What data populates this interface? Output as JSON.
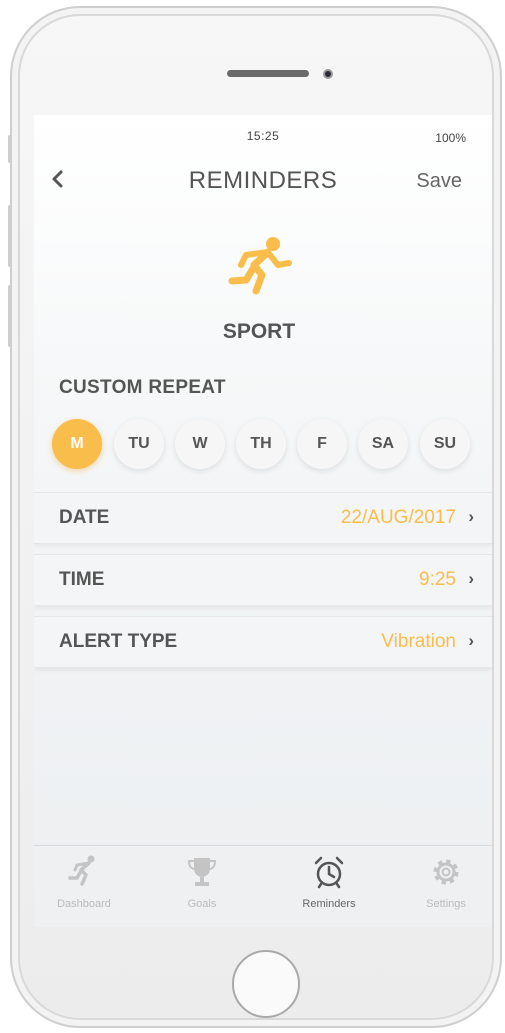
{
  "status": {
    "time": "15:25",
    "battery": "100%"
  },
  "nav": {
    "back_icon": "chevron-left-icon",
    "back_label": "‹",
    "title": "REMINDERS",
    "save_label": "Save"
  },
  "reminder": {
    "icon": "running-person-icon",
    "category": "SPORT"
  },
  "repeat": {
    "title": "CUSTOM REPEAT",
    "days": [
      {
        "label": "M",
        "selected": true
      },
      {
        "label": "TU",
        "selected": false
      },
      {
        "label": "W",
        "selected": false
      },
      {
        "label": "TH",
        "selected": false
      },
      {
        "label": "F",
        "selected": false
      },
      {
        "label": "SA",
        "selected": false
      },
      {
        "label": "SU",
        "selected": false
      }
    ]
  },
  "rows": {
    "date": {
      "label": "DATE",
      "value": "22/AUG/2017",
      "chevron": "›"
    },
    "time": {
      "label": "TIME",
      "value": "9:25",
      "chevron": "›"
    },
    "alert": {
      "label": "ALERT TYPE",
      "value": "Vibration",
      "chevron": "›"
    }
  },
  "tabs": [
    {
      "label": "Dashboard",
      "icon": "running-person-icon",
      "active": false
    },
    {
      "label": "Goals",
      "icon": "trophy-icon",
      "active": false
    },
    {
      "label": "Reminders",
      "icon": "alarm-clock-icon",
      "active": true
    },
    {
      "label": "Settings",
      "icon": "gear-icon",
      "active": false
    }
  ],
  "colors": {
    "accent": "#f9bd4b",
    "text": "#555555",
    "inactive": "#bbbbbb"
  }
}
